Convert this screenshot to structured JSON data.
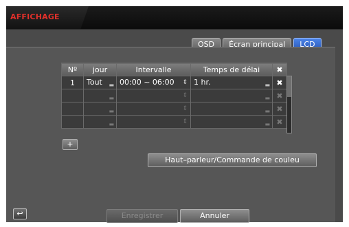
{
  "window_title": "AFFICHAGE",
  "tabs": [
    {
      "label": "OSD",
      "active": false
    },
    {
      "label": "Écran principal",
      "active": false
    },
    {
      "label": "LCD",
      "active": true
    }
  ],
  "table": {
    "headers": {
      "no": "Nº",
      "jour": "jour",
      "intervalle": "Intervalle",
      "delai": "Temps de délai",
      "delete": "✖"
    },
    "rows": [
      {
        "no": "1",
        "jour": "Tout",
        "intervalle": "00:00 ~ 06:00",
        "delai": "1 hr."
      },
      {
        "no": "",
        "jour": "",
        "intervalle": "",
        "delai": ""
      },
      {
        "no": "",
        "jour": "",
        "intervalle": "",
        "delai": ""
      },
      {
        "no": "",
        "jour": "",
        "intervalle": "",
        "delai": ""
      }
    ]
  },
  "add_button": "+",
  "speaker_button": "Haut–parleur/Commande de couleu",
  "save_button": "Enregistrer",
  "cancel_button": "Annuler",
  "back_icon": "return-arrow-icon",
  "colors": {
    "title": "#e0302a",
    "active_tab": "#2f62c8",
    "panel": "#565656"
  }
}
